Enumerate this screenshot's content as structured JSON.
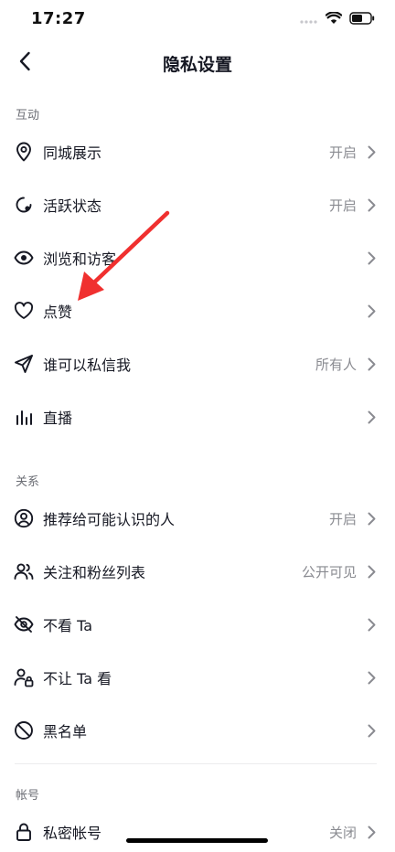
{
  "status_bar": {
    "time": "17:27"
  },
  "nav": {
    "title": "隐私设置"
  },
  "sections": {
    "interaction": {
      "title": "互动"
    },
    "relations": {
      "title": "关系"
    },
    "account": {
      "title": "帐号"
    }
  },
  "rows": {
    "city_display": {
      "label": "同城展示",
      "value": "开启"
    },
    "active_status": {
      "label": "活跃状态",
      "value": "开启"
    },
    "browse_visitors": {
      "label": "浏览和访客",
      "value": ""
    },
    "likes": {
      "label": "点赞",
      "value": ""
    },
    "who_can_message": {
      "label": "谁可以私信我",
      "value": "所有人"
    },
    "live": {
      "label": "直播",
      "value": ""
    },
    "recommend_to_contacts": {
      "label": "推荐给可能认识的人",
      "value": "开启"
    },
    "follow_fans_list": {
      "label": "关注和粉丝列表",
      "value": "公开可见"
    },
    "hide_ta": {
      "label": "不看 Ta",
      "value": ""
    },
    "block_ta_viewing": {
      "label": "不让 Ta 看",
      "value": ""
    },
    "blacklist": {
      "label": "黑名单",
      "value": ""
    },
    "private_account": {
      "label": "私密帐号",
      "value": "关闭"
    }
  },
  "colors": {
    "annotation_arrow": "#f0302f",
    "text": "#161823",
    "secondary": "#8a8b91"
  }
}
